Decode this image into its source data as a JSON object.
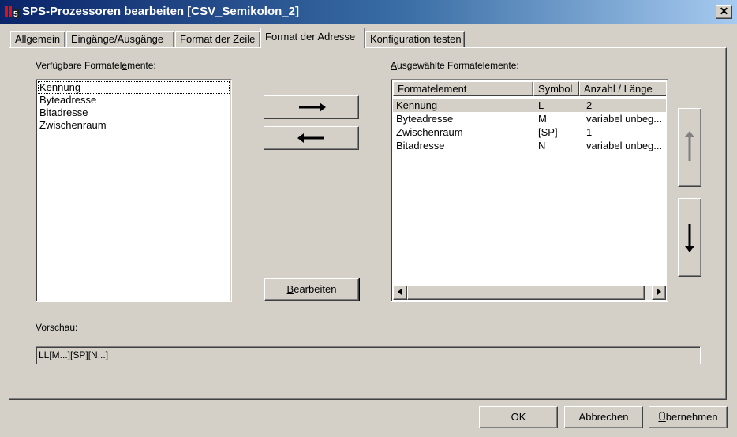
{
  "window": {
    "title": "SPS-Prozessoren bearbeiten [CSV_Semikolon_2]",
    "close_glyph": "✕"
  },
  "tabs": [
    {
      "label": "Allgemein",
      "active": false
    },
    {
      "label": "Eingänge/Ausgänge",
      "active": false
    },
    {
      "label": "Format der Zeile",
      "active": false
    },
    {
      "label": "Format der Adresse",
      "active": true
    },
    {
      "label": "Konfiguration testen",
      "active": false
    }
  ],
  "available": {
    "label_pre": "Verfügbare Formatel",
    "label_mnemonic": "e",
    "label_post": "mente:",
    "items": [
      "Kennung",
      "Byteadresse",
      "Bitadresse",
      "Zwischenraum"
    ]
  },
  "move_buttons": {
    "add_icon": "arrow-right-icon",
    "remove_icon": "arrow-left-icon"
  },
  "edit_button": {
    "mnemonic": "B",
    "rest": "earbeiten"
  },
  "selected": {
    "label_pre": "",
    "label_mnemonic": "A",
    "label_post": "usgewählte Formatelemente:",
    "columns": [
      "Formatelement",
      "Symbol",
      "Anzahl / Länge"
    ],
    "rows": [
      {
        "element": "Kennung",
        "symbol": "L",
        "length": "2",
        "selected": true
      },
      {
        "element": "Byteadresse",
        "symbol": "M",
        "length": "variabel unbeg...",
        "selected": false
      },
      {
        "element": "Zwischenraum",
        "symbol": "[SP]",
        "length": "1",
        "selected": false
      },
      {
        "element": "Bitadresse",
        "symbol": "N",
        "length": "variabel unbeg...",
        "selected": false
      }
    ]
  },
  "preview": {
    "label": "Vorschau:",
    "value": "LL[M...][SP][N...]"
  },
  "footer": {
    "ok": "OK",
    "cancel": "Abbrechen",
    "apply_mnemonic": "Ü",
    "apply_rest": "bernehmen"
  },
  "colors": {
    "titlebar_start": "#0a246a",
    "titlebar_end": "#a6caf0",
    "face": "#d4d0c8"
  }
}
